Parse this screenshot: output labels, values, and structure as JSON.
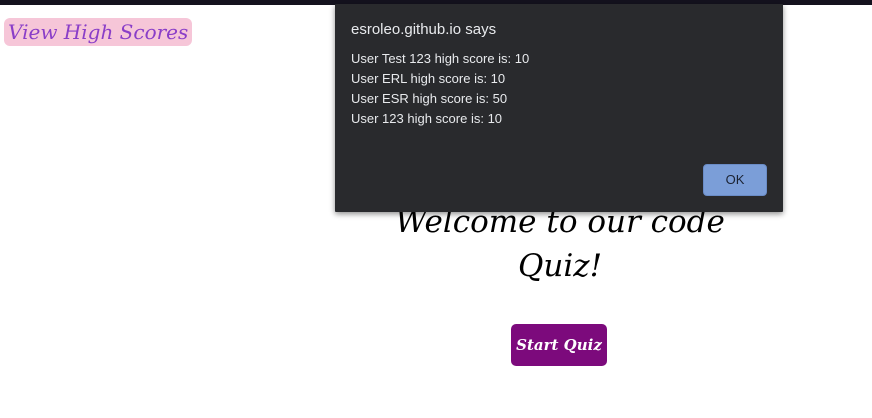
{
  "header": {
    "view_high_scores": "View High Scores"
  },
  "main": {
    "welcome_line1": "Welcome to our code",
    "welcome_line2": "Quiz!",
    "start_button": "Start Quiz"
  },
  "dialog": {
    "title": "esroleo.github.io says",
    "lines": [
      "User Test 123 high score is: 10",
      "User ERL high score is: 10",
      "User ESR high score is: 50",
      "User 123 high score is: 10"
    ],
    "ok_label": "OK"
  },
  "colors": {
    "start_button_bg": "#7c0a7c",
    "high_scores_bg": "#f6c6d8",
    "high_scores_text": "#8a3ec8",
    "dialog_bg": "#292a2d",
    "ok_button_bg": "#7b9ed8"
  }
}
